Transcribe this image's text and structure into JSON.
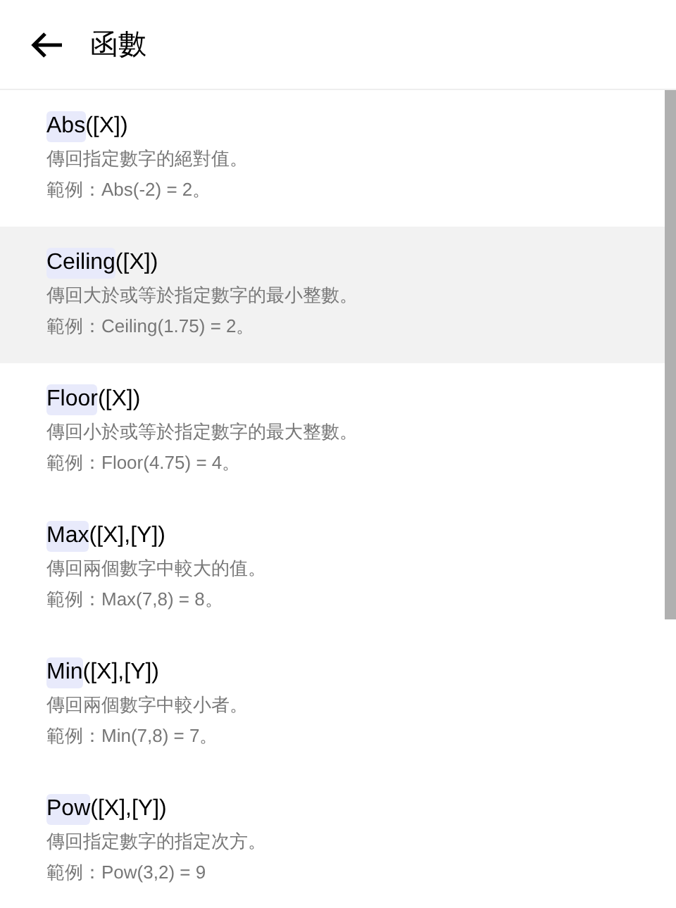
{
  "header": {
    "title": "函數"
  },
  "functions": [
    {
      "name": "Abs",
      "args": "([X])",
      "description": "傳回指定數字的絕對值。",
      "example": "範例：Abs(-2) = 2。",
      "selected": false
    },
    {
      "name": "Ceiling",
      "args": "([X])",
      "description": "傳回大於或等於指定數字的最小整數。",
      "example": "範例：Ceiling(1.75) = 2。",
      "selected": true
    },
    {
      "name": "Floor",
      "args": "([X])",
      "description": "傳回小於或等於指定數字的最大整數。",
      "example": "範例：Floor(4.75) = 4。",
      "selected": false
    },
    {
      "name": "Max",
      "args": "([X],[Y])",
      "description": "傳回兩個數字中較大的值。",
      "example": "範例：Max(7,8) = 8。",
      "selected": false
    },
    {
      "name": "Min",
      "args": "([X],[Y])",
      "description": "傳回兩個數字中較小者。",
      "example": "範例：Min(7,8) = 7。",
      "selected": false
    },
    {
      "name": "Pow",
      "args": "([X],[Y])",
      "description": "傳回指定數字的指定次方。",
      "example": "範例：Pow(3,2) = 9",
      "selected": false
    }
  ]
}
